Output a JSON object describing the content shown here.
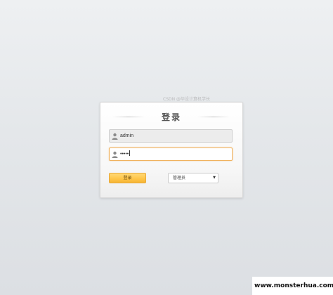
{
  "login": {
    "title": "登录",
    "username_value": "admin",
    "password_value": "•••••",
    "submit_label": "登录",
    "role_selected": "管理员"
  },
  "icons": {
    "username_icon": "user-icon",
    "password_icon": "user-icon",
    "role_dropdown": "triangle-down-icon"
  },
  "colors": {
    "button": "#ffc64a",
    "focus_border": "#f0b25e"
  },
  "watermarks": {
    "csdn": "CSDN @毕设计算机学长",
    "site": "www.monsterhua.com"
  }
}
